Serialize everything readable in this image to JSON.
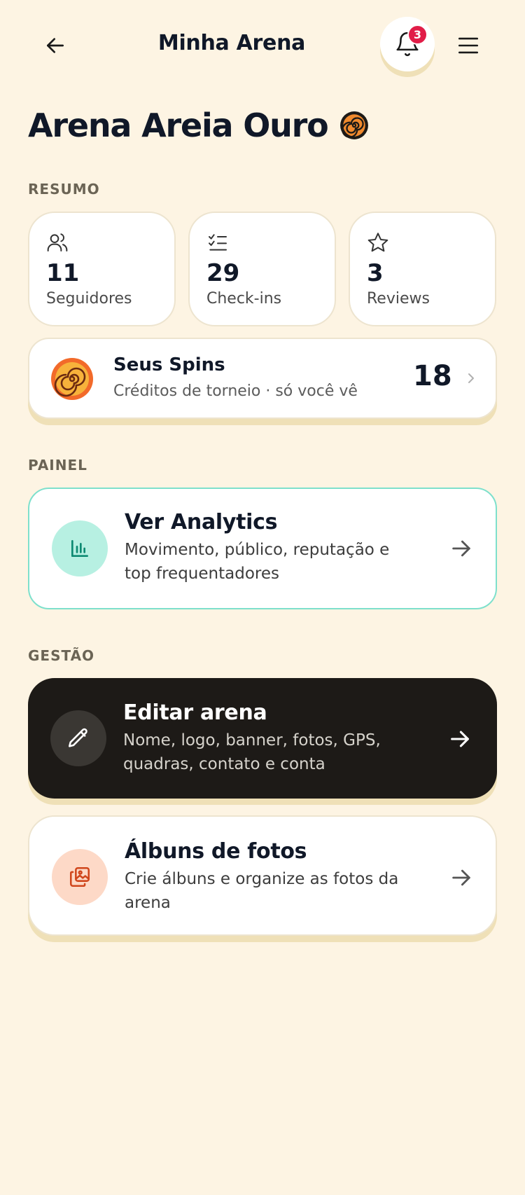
{
  "header": {
    "title": "Minha Arena",
    "notification_count": "3",
    "back_icon": "arrow-left-icon",
    "bell_icon": "bell-icon",
    "menu_icon": "hamburger-menu-icon"
  },
  "arena": {
    "name": "Arena Areia Ouro",
    "badge_icon": "spin-coin-icon"
  },
  "resumo": {
    "label": "RESUMO",
    "stats": [
      {
        "icon": "users-icon",
        "value": "11",
        "label": "Seguidores"
      },
      {
        "icon": "checklist-icon",
        "value": "29",
        "label": "Check-ins"
      },
      {
        "icon": "star-icon",
        "value": "3",
        "label": "Reviews"
      }
    ]
  },
  "spins": {
    "title": "Seus Spins",
    "subtitle": "Créditos de torneio · só você vê",
    "value": "18",
    "icon": "spin-coin-icon"
  },
  "painel": {
    "label": "PAINEL",
    "analytics": {
      "title": "Ver Analytics",
      "description": "Movimento, público, reputação e top frequentadores",
      "icon": "bar-chart-icon"
    }
  },
  "gestao": {
    "label": "GESTÃO",
    "edit": {
      "title": "Editar arena",
      "description": "Nome, logo, banner, fotos, GPS, quadras, contato e conta",
      "icon": "pencil-icon"
    },
    "albums": {
      "title": "Álbuns de fotos",
      "description": "Crie álbuns e organize as fotos da arena",
      "icon": "photo-album-icon"
    }
  },
  "colors": {
    "background": "#fdf4e3",
    "accent_teal": "#7ee0cc",
    "badge_red": "#e11d48",
    "dark_card": "#1d1a17",
    "coin_orange": "#f26a2a"
  }
}
